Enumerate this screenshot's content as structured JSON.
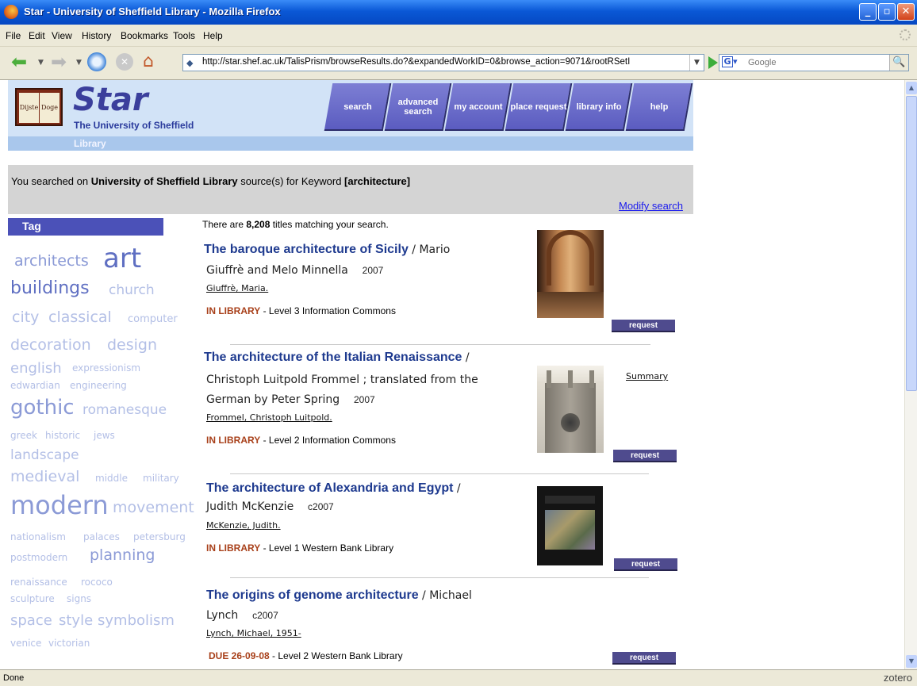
{
  "window": {
    "title": "Star - University of Sheffield Library - Mozilla Firefox",
    "min": "_",
    "max": "▫",
    "close": "✕"
  },
  "menu": [
    "File",
    "Edit",
    "View",
    "History",
    "Bookmarks",
    "Tools",
    "Help"
  ],
  "toolbar": {
    "url": "http://star.shef.ac.uk/TalisPrism/browseResults.do?&expandedWorkID=0&browse_action=9071&rootRSetI",
    "search_placeholder": "Google",
    "icons": [
      "back-icon",
      "forward-icon",
      "reload-icon",
      "stop-icon",
      "home-icon",
      "go-icon",
      "search-icon"
    ]
  },
  "header": {
    "logo_left": "Dijste",
    "logo_right": "Doge",
    "brand": "Star",
    "university": "The University of Sheffield",
    "library": "Library",
    "nav": [
      {
        "label": "search"
      },
      {
        "label": "advanced search"
      },
      {
        "label": "my account"
      },
      {
        "label": "place request"
      },
      {
        "label": "library info"
      },
      {
        "label": "help"
      }
    ]
  },
  "search_info": {
    "prefix": "You searched on ",
    "source": "University of Sheffield Library",
    "middle": " source(s) for Keyword ",
    "keyword": "[architecture]",
    "modify": "Modify search"
  },
  "tags": {
    "header": "Tag",
    "items": [
      "architects",
      "art",
      "buildings",
      "church",
      "city",
      "classical",
      "computer",
      "decoration",
      "design",
      "english",
      "expressionism",
      "edwardian",
      "engineering",
      "gothic",
      "romanesque",
      "greek",
      "historic",
      "jews",
      "landscape",
      "medieval",
      "middle",
      "military",
      "modern",
      "movement",
      "nationalism",
      "palaces",
      "petersburg",
      "postmodern",
      "planning",
      "renaissance",
      "rococo",
      "sculpture",
      "signs",
      "space",
      "style",
      "symbolism",
      "venice",
      "victorian"
    ]
  },
  "results": {
    "count_prefix": "There are ",
    "count": "8,208",
    "count_suffix": " titles matching your search.",
    "summary": "Summary",
    "request_label": "request",
    "items": [
      {
        "title": "The baroque architecture of Sicily",
        "author_line1": " / Mario",
        "author_line2": "Giuffrè and Melo Minnella",
        "year": "2007",
        "author_link": "Giuffrè, Maria.",
        "status": "IN LIBRARY",
        "location": " - Level 3  Information Commons"
      },
      {
        "title": "The architecture of the Italian Renaissance",
        "author_line1": " /",
        "author_line2": "Christoph Luitpold Frommel ; translated from the",
        "author_line3": "German by Peter Spring",
        "year": "2007",
        "author_link": "Frommel, Christoph Luitpold.",
        "status": "IN LIBRARY",
        "location": " - Level 2  Information Commons"
      },
      {
        "title": "The architecture of Alexandria and Egypt",
        "author_line1": " /",
        "author_line2": "Judith McKenzie",
        "year": "c2007",
        "author_link": "McKenzie, Judith.",
        "status": "IN LIBRARY",
        "location": " - Level 1   Western Bank Library"
      },
      {
        "title": "The origins of genome architecture",
        "author_line1": " / Michael",
        "author_line2": "Lynch",
        "year": "c2007",
        "author_link": "Lynch, Michael, 1951-",
        "status": "DUE 26-09-08",
        "location": " - Level 2   Western Bank Library"
      }
    ]
  },
  "status_bar": {
    "text": "Done",
    "addon": "zotero"
  }
}
